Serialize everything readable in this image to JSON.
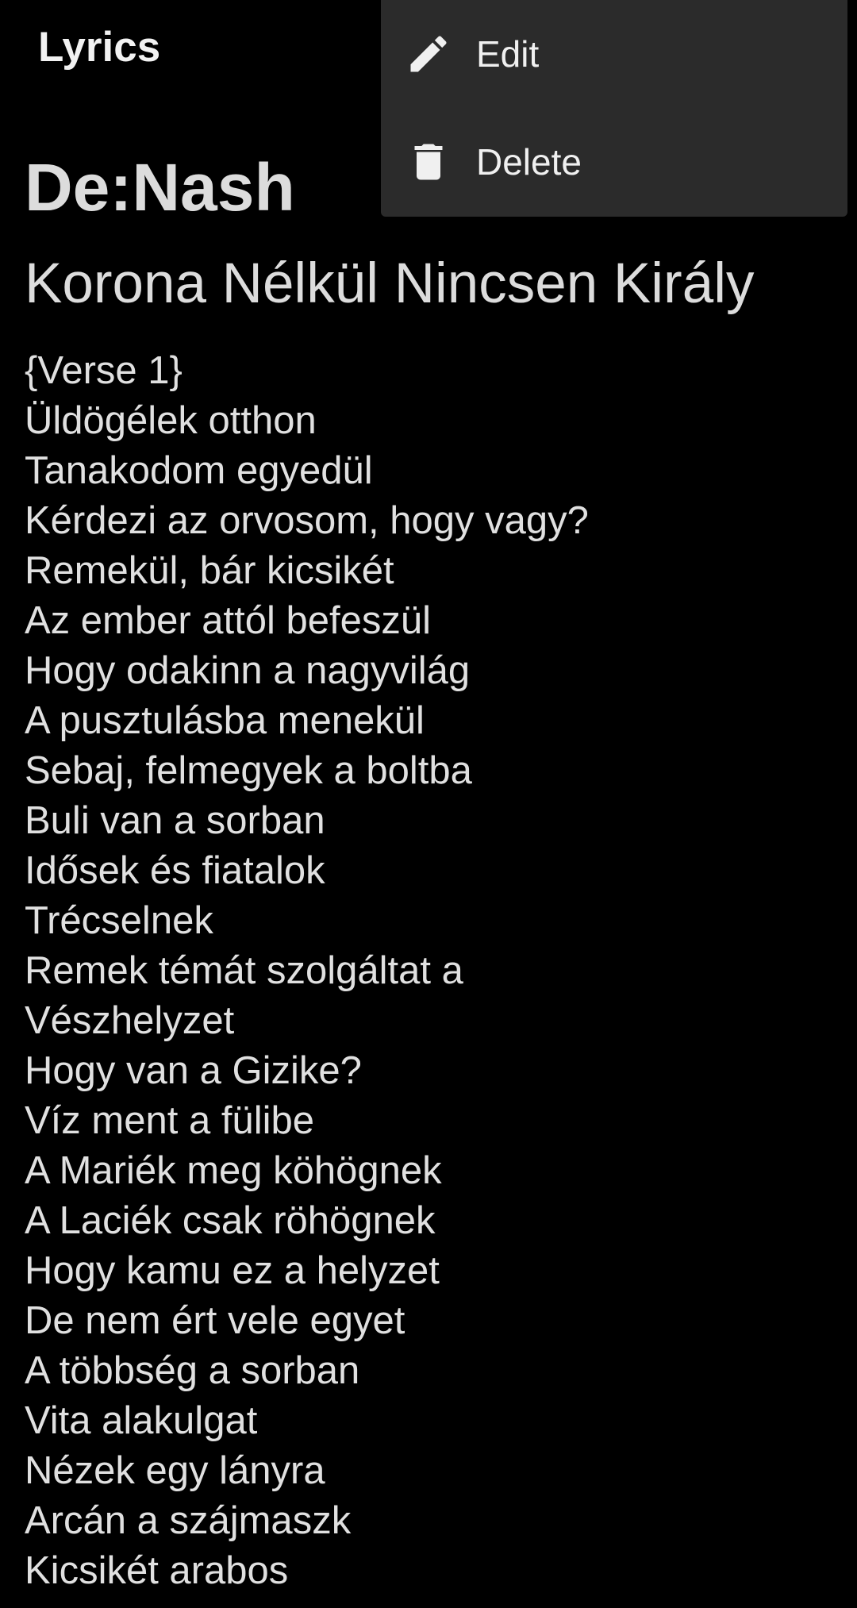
{
  "app_bar": {
    "title": "Lyrics"
  },
  "menu": {
    "items": [
      {
        "label": "Edit",
        "icon": "pencil-icon"
      },
      {
        "label": "Delete",
        "icon": "trash-icon"
      }
    ]
  },
  "song": {
    "artist": "De:Nash",
    "title": "Korona Nélkül Nincsen Király",
    "lyrics": [
      "{Verse 1}",
      "Üldögélek otthon",
      "Tanakodom egyedül",
      "Kérdezi az orvosom, hogy vagy?",
      "Remekül, bár kicsikét",
      "Az ember attól befeszül",
      "Hogy odakinn a nagyvilág",
      "A pusztulásba menekül",
      "Sebaj, felmegyek a boltba",
      "Buli van a sorban",
      "Idősek és fiatalok",
      "Trécselnek",
      "Remek témát szolgáltat a",
      "Vészhelyzet",
      "Hogy van a Gizike?",
      "Víz ment a fülibe",
      "A Mariék meg köhögnek",
      "A Laciék csak röhögnek",
      "Hogy kamu ez a helyzet",
      "De nem ért vele egyet",
      "A többség a sorban",
      "Vita alakulgat",
      "Nézek egy lányra",
      "Arcán a szájmaszk",
      "Kicsikét arabos"
    ]
  },
  "colors": {
    "background": "#000000",
    "menu_background": "#2b2b2b",
    "text": "#dcdcdc"
  }
}
